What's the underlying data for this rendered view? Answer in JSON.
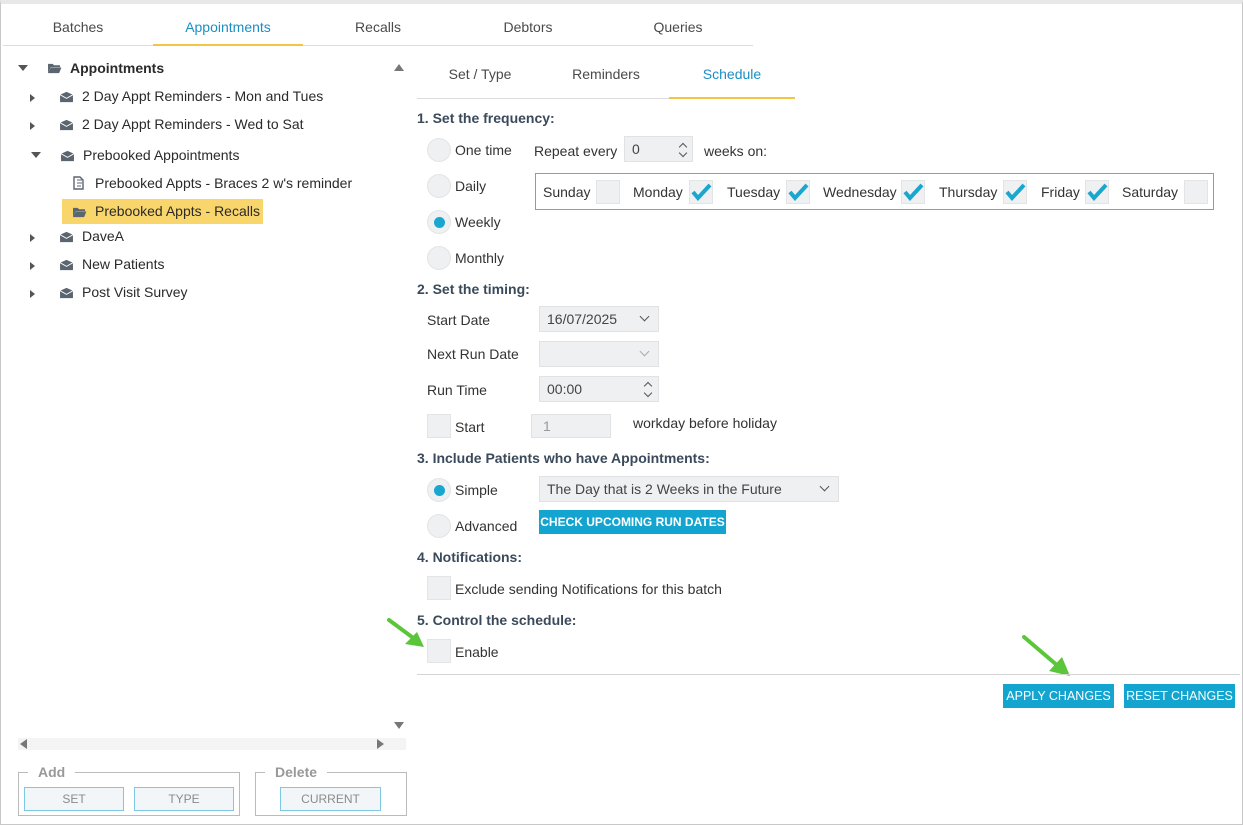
{
  "top_tabs": [
    "Batches",
    "Appointments",
    "Recalls",
    "Debtors",
    "Queries"
  ],
  "tree": {
    "root": "Appointments",
    "items": [
      "2 Day Appt Reminders - Mon and Tues",
      "2 Day Appt Reminders - Wed to Sat",
      "Prebooked Appointments",
      "Prebooked Appts - Braces 2 w's reminder",
      "Prebooked Appts - Recalls",
      "DaveA",
      "New Patients",
      "Post Visit Survey"
    ]
  },
  "bottom_left": {
    "add_legend": "Add",
    "set_label": "SET",
    "type_label": "TYPE",
    "delete_legend": "Delete",
    "current_label": "CURRENT"
  },
  "sub_tabs": [
    "Set / Type",
    "Reminders",
    "Schedule"
  ],
  "frequency": {
    "title": "1. Set the frequency:",
    "options": [
      "One time",
      "Daily",
      "Weekly",
      "Monthly"
    ],
    "selected": "Weekly",
    "repeat_label": "Repeat every",
    "repeat_value": "0",
    "weeks_on": "weeks on:",
    "days": [
      {
        "name": "Sunday",
        "checked": false
      },
      {
        "name": "Monday",
        "checked": true
      },
      {
        "name": "Tuesday",
        "checked": true
      },
      {
        "name": "Wednesday",
        "checked": true
      },
      {
        "name": "Thursday",
        "checked": true
      },
      {
        "name": "Friday",
        "checked": true
      },
      {
        "name": "Saturday",
        "checked": false
      }
    ]
  },
  "timing": {
    "title": "2. Set the timing:",
    "start_date_label": "Start Date",
    "start_date_value": "16/07/2025",
    "next_run_label": "Next Run Date",
    "next_run_value": "",
    "run_time_label": "Run Time",
    "run_time_value": "00:00",
    "start_label": "Start",
    "start_value": "1",
    "workday_text": "workday before holiday"
  },
  "include": {
    "title": "3. Include Patients who have Appointments:",
    "simple_label": "Simple",
    "advanced_label": "Advanced",
    "simple_value": "The Day that is 2 Weeks in the Future",
    "check_button": "CHECK UPCOMING RUN DATES"
  },
  "notifications": {
    "title": "4. Notifications:",
    "exclude_label": "Exclude sending Notifications for this batch"
  },
  "control": {
    "title": "5. Control the schedule:",
    "enable_label": "Enable"
  },
  "actions": {
    "apply": "APPLY CHANGES",
    "reset": "RESET CHANGES"
  },
  "colors": {
    "accent": "#13a5d0",
    "tab_underline": "#f4c542",
    "selected_item": "#f9d66b",
    "annotation_arrow": "#5cc63a"
  }
}
